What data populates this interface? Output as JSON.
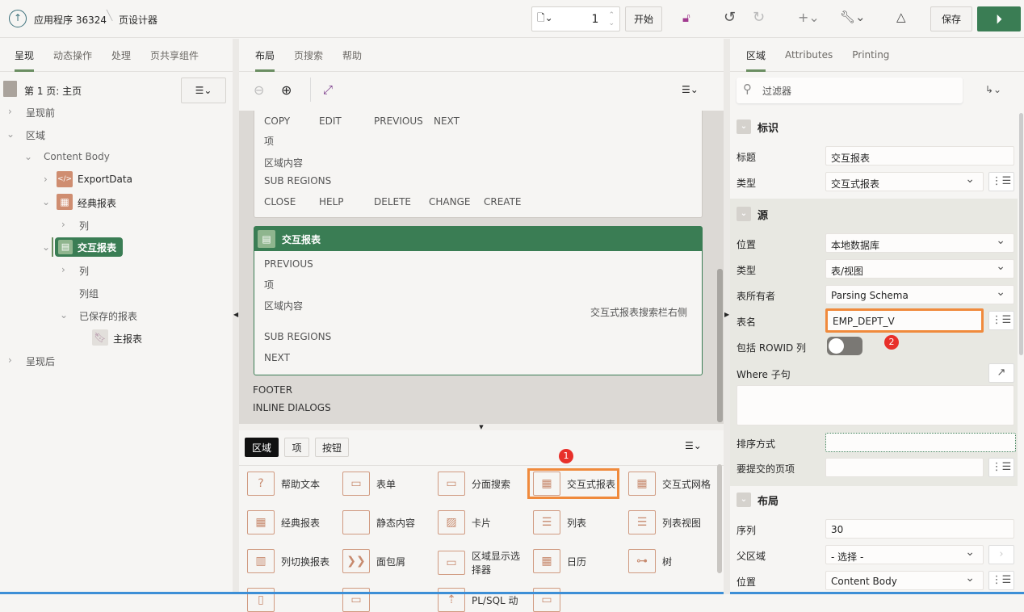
{
  "header": {
    "app": "应用程序 36324",
    "page": "页设计器",
    "page_number": "1",
    "start": "开始",
    "save": "保存",
    "icons": [
      "up-arrow-icon",
      "page-icon",
      "unlock-icon",
      "undo-icon",
      "redo-icon",
      "plus-icon",
      "wrench-icon",
      "shapes-icon",
      "run-icon"
    ]
  },
  "left": {
    "tabs": [
      "呈现",
      "动态操作",
      "处理",
      "页共享组件"
    ],
    "page_title": "第 1 页: 主页",
    "tree": [
      "呈现前",
      "区域",
      "Content Body",
      "ExportData",
      "经典报表",
      "列",
      "交互报表",
      "列",
      "列组",
      "已保存的报表",
      "主报表",
      "呈现后"
    ]
  },
  "center": {
    "tabs": [
      "布局",
      "页搜索",
      "帮助"
    ],
    "card1": {
      "buttons": [
        "COPY",
        "EDIT",
        "PREVIOUS",
        "NEXT"
      ],
      "items": "项",
      "content": "区域内容",
      "sub": "SUB REGIONS",
      "buttons2": [
        "CLOSE",
        "HELP",
        "DELETE",
        "CHANGE",
        "CREATE"
      ]
    },
    "card2": {
      "title": "交互报表",
      "prev": "PREVIOUS",
      "items": "项",
      "content": "区域内容",
      "search_right": "交互式报表搜索栏右侧",
      "sub": "SUB REGIONS",
      "next": "NEXT"
    },
    "footer": "FOOTER",
    "inline": "INLINE DIALOGS",
    "gallery_tabs": [
      "区域",
      "项",
      "按钮"
    ],
    "gallery": [
      [
        "帮助文本",
        "表单",
        "分面搜索",
        "交互式报表",
        "交互式网格"
      ],
      [
        "经典报表",
        "静态内容",
        "卡片",
        "列表",
        "列表视图"
      ],
      [
        "列切换报表",
        "面包屑",
        "区域显示选择器",
        "日历",
        "树"
      ],
      [
        "",
        "",
        "PL/SQL 动",
        "",
        ""
      ]
    ]
  },
  "right": {
    "tabs": [
      "区域",
      "Attributes",
      "Printing"
    ],
    "filter_placeholder": "过滤器",
    "sections": {
      "identification": "标识",
      "source": "源",
      "layout": "布局"
    },
    "fields": {
      "title_label": "标题",
      "title": "交互报表",
      "type_label": "类型",
      "type": "交互式报表",
      "location_label": "位置",
      "location": "本地数据库",
      "src_type_label": "类型",
      "src_type": "表/视图",
      "owner_label": "表所有者",
      "owner": "Parsing Schema",
      "table_label": "表名",
      "table": "EMP_DEPT_V",
      "rowid_label": "包括 ROWID 列",
      "rowid": false,
      "where_label": "Where 子句",
      "where": "",
      "order_label": "排序方式",
      "order": "",
      "submit_label": "要提交的页项",
      "submit": "",
      "seq_label": "序列",
      "seq": "30",
      "parent_label": "父区域",
      "parent": "- 选择 -",
      "pos_label": "位置",
      "pos": "Content Body"
    }
  },
  "badges": [
    "1",
    "2"
  ],
  "colors": {
    "accent": "#3a7d54",
    "highlight": "#f08a3c",
    "badge": "#e8302a"
  }
}
